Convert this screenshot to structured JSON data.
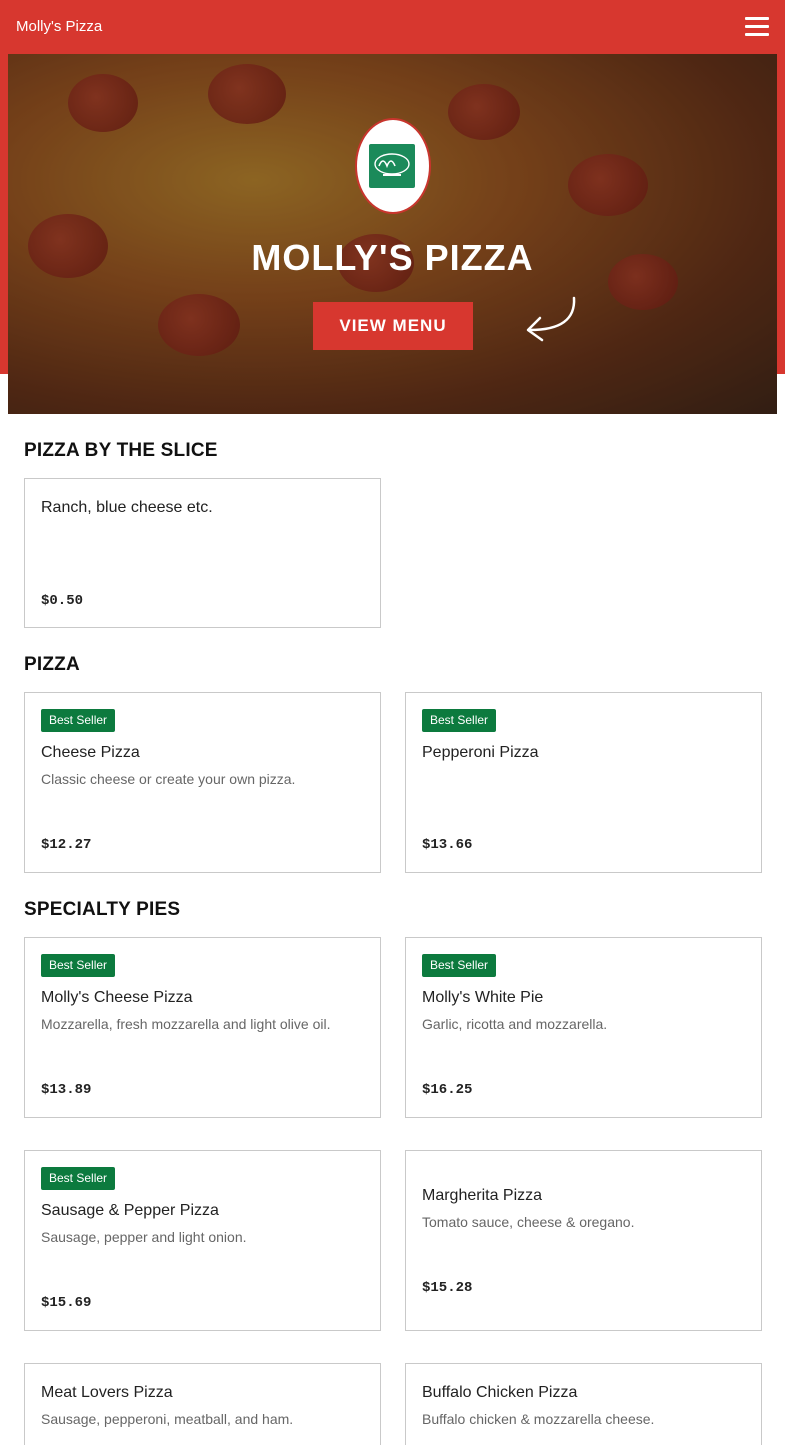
{
  "header": {
    "brand": "Molly's Pizza",
    "menu_icon": "hamburger-icon"
  },
  "hero": {
    "logo": "Molly's Pizzeria",
    "title": "MOLLY'S PIZZA",
    "button_label": "VIEW MENU"
  },
  "sections": [
    {
      "title": "PIZZA BY THE SLICE",
      "items": [
        {
          "name": "Ranch, blue cheese etc.",
          "description": "",
          "price": "$0.50",
          "badge": ""
        }
      ]
    },
    {
      "title": "PIZZA",
      "items": [
        {
          "name": "Cheese Pizza",
          "description": "Classic cheese or create your own pizza.",
          "price": "$12.27",
          "badge": "Best Seller"
        },
        {
          "name": "Pepperoni Pizza",
          "description": "",
          "price": "$13.66",
          "badge": "Best Seller"
        }
      ]
    },
    {
      "title": "SPECIALTY PIES",
      "items": [
        {
          "name": "Molly's Cheese Pizza",
          "description": "Mozzarella, fresh mozzarella and light olive oil.",
          "price": "$13.89",
          "badge": "Best Seller"
        },
        {
          "name": "Molly's White Pie",
          "description": "Garlic, ricotta and mozzarella.",
          "price": "$16.25",
          "badge": "Best Seller"
        },
        {
          "name": "Sausage & Pepper Pizza",
          "description": "Sausage, pepper and light onion.",
          "price": "$15.69",
          "badge": "Best Seller"
        },
        {
          "name": "Margherita Pizza",
          "description": "Tomato sauce, cheese & oregano.",
          "price": "$15.28",
          "badge": ""
        },
        {
          "name": "Meat Lovers Pizza",
          "description": "Sausage, pepperoni, meatball, and ham.",
          "price": "",
          "badge": ""
        },
        {
          "name": "Buffalo Chicken Pizza",
          "description": "Buffalo chicken & mozzarella cheese.",
          "price": "",
          "badge": ""
        }
      ]
    }
  ],
  "colors": {
    "brand_red": "#d7372f",
    "badge_green": "#0c7a3e",
    "logo_green": "#1b8a5a"
  }
}
